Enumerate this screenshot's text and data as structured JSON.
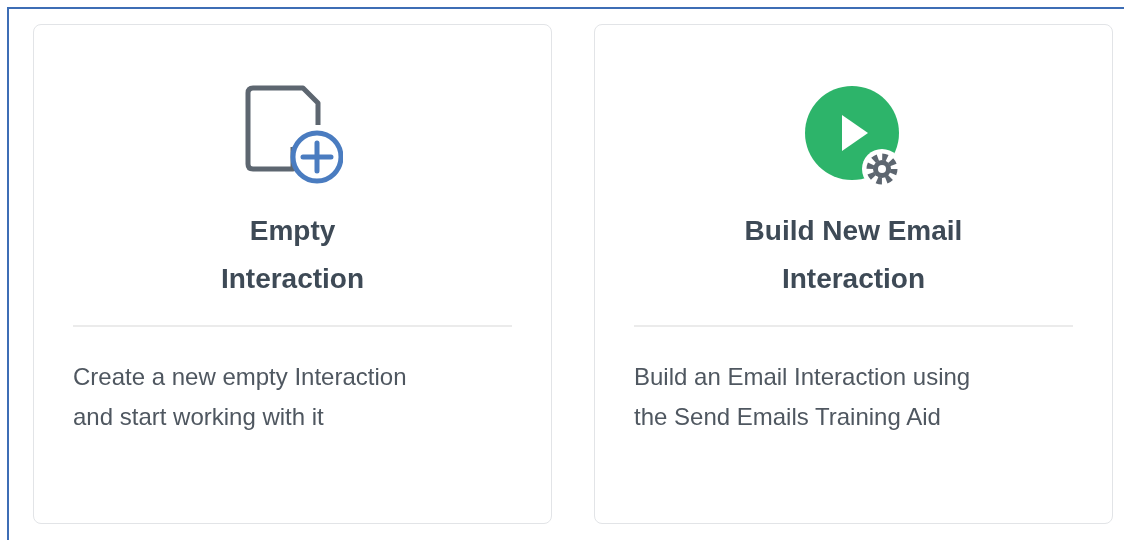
{
  "cards": [
    {
      "kind": "new-document",
      "title_lines": [
        "Empty",
        "Interaction"
      ],
      "description_lines": [
        "Create a new empty Interaction",
        "and start working with it"
      ]
    },
    {
      "kind": "email-play",
      "title_lines": [
        "Build New Email",
        "Interaction"
      ],
      "description_lines": [
        "Build an Email Interaction using",
        "the Send Emails Training Aid"
      ]
    }
  ]
}
